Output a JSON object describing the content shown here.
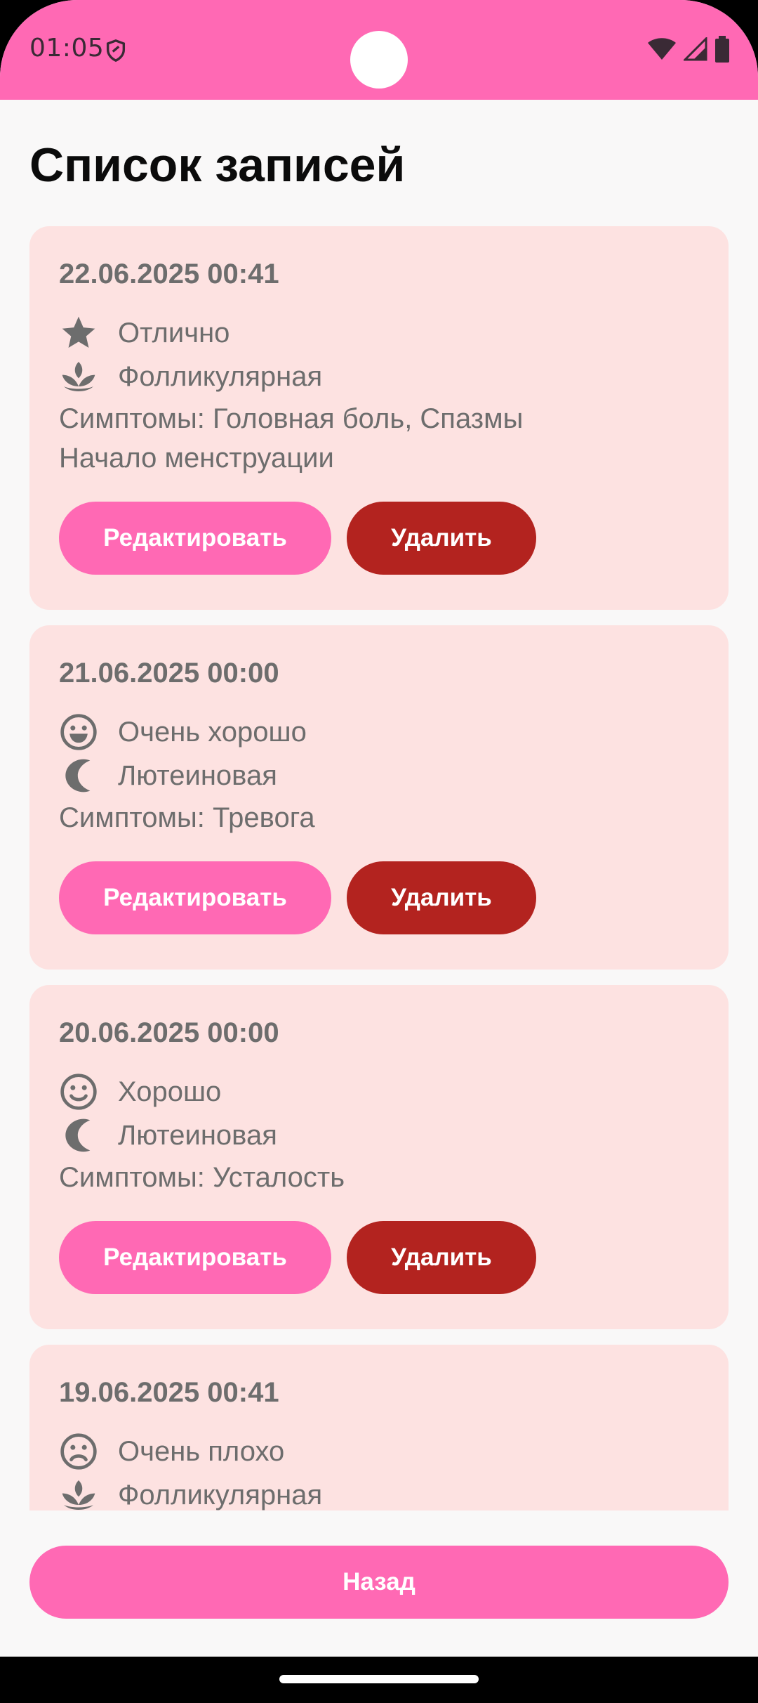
{
  "status_bar": {
    "time": "01:05"
  },
  "page": {
    "title": "Список записей"
  },
  "actions": {
    "edit_label": "Редактировать",
    "delete_label": "Удалить"
  },
  "entries": [
    {
      "date": "22.06.2025 00:41",
      "mood": {
        "label": "Отлично",
        "icon": "star-icon"
      },
      "phase": {
        "label": "Фолликулярная",
        "icon": "lotus-icon"
      },
      "symptoms": "Симптомы: Головная боль, Спазмы",
      "note": "Начало менструации"
    },
    {
      "date": "21.06.2025 00:00",
      "mood": {
        "label": "Очень хорошо",
        "icon": "grin-face-icon"
      },
      "phase": {
        "label": "Лютеиновая",
        "icon": "crescent-moon-icon"
      },
      "symptoms": "Симптомы: Тревога"
    },
    {
      "date": "20.06.2025 00:00",
      "mood": {
        "label": "Хорошо",
        "icon": "smile-face-icon"
      },
      "phase": {
        "label": "Лютеиновая",
        "icon": "crescent-moon-icon"
      },
      "symptoms": "Симптомы: Усталость"
    },
    {
      "date": "19.06.2025 00:41",
      "mood": {
        "label": "Очень плохо",
        "icon": "sad-face-icon"
      },
      "phase": {
        "label": "Фолликулярная",
        "icon": "lotus-icon"
      }
    }
  ],
  "footer": {
    "back_label": "Назад"
  },
  "colors": {
    "accent": "#ff69b4",
    "danger": "#b3231f",
    "card": "#fde2e1",
    "text_muted": "#6d6d6d"
  }
}
